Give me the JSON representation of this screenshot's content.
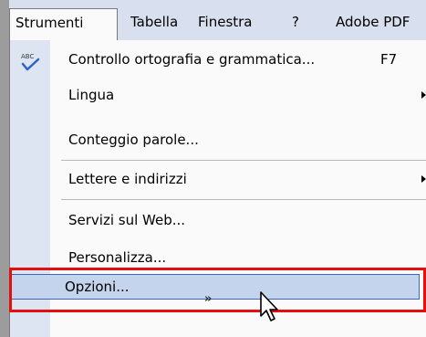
{
  "menubar": {
    "items": [
      {
        "label": "Strumenti",
        "open": true
      },
      {
        "label": "Tabella"
      },
      {
        "label": "Finestra"
      },
      {
        "label": "?"
      },
      {
        "label": "Adobe PDF"
      }
    ]
  },
  "menu": {
    "items": [
      {
        "label": "Controllo ortografia e grammatica...",
        "shortcut": "F7",
        "icon": "spellcheck-icon"
      },
      {
        "label": "Lingua",
        "submenu": true
      },
      {
        "label": "Conteggio parole..."
      },
      {
        "label": "Lettere e indirizzi",
        "submenu": true
      },
      {
        "label": "Servizi sul Web..."
      },
      {
        "label": "Personalizza..."
      },
      {
        "label": "Opzioni...",
        "highlighted": true
      }
    ],
    "expand_glyph": "»"
  },
  "colors": {
    "menubar_bg": "#d8e0ef",
    "gutter_bg": "#dde4f2",
    "highlight_bg": "#c3d4ec",
    "highlight_border": "#3e67b3",
    "annotation_frame": "#e41010"
  }
}
